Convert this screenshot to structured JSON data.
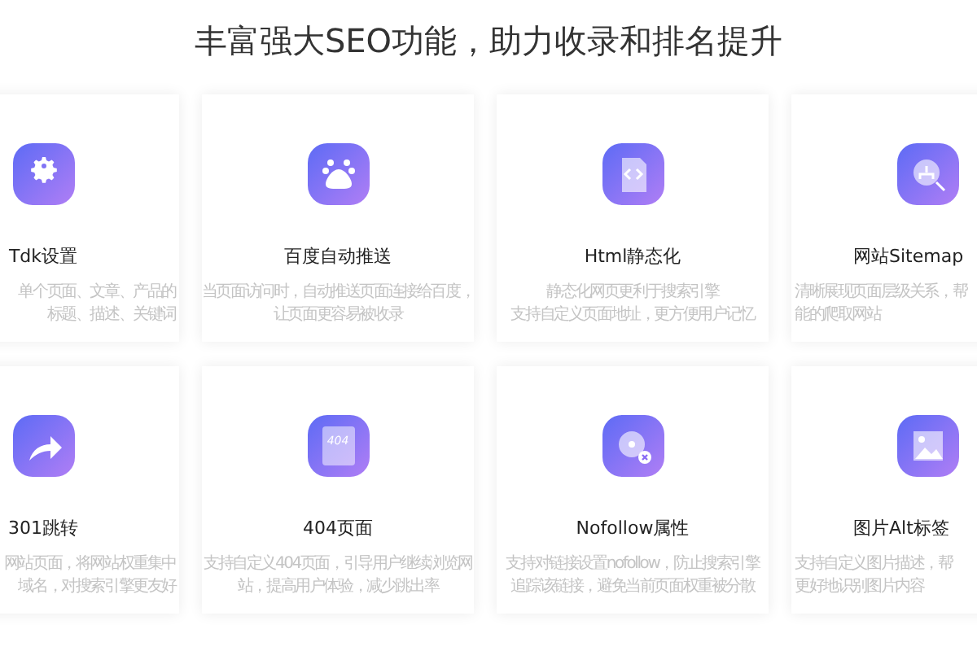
{
  "heading": "丰富强大SEO功能，助力收录和排名提升",
  "cards": [
    {
      "title": "Tdk设置",
      "description": [
        "单个页面、文章、产品的",
        "标题、描述、关键词"
      ]
    },
    {
      "title": "百度自动推送",
      "description": [
        "当页面访问时，自动推送页面连接给百度，",
        "让页面更容易被收录"
      ]
    },
    {
      "title": "Html静态化",
      "description": [
        "静态化网页更利于搜索引擎",
        "支持自定义页面地址，更方便用户记忆"
      ]
    },
    {
      "title": "网站Sitemap",
      "description": [
        "清晰展现页面层级关系，帮",
        "能的爬取网站"
      ]
    },
    {
      "title": "301跳转",
      "description": [
        "网站页面，将网站权重集中",
        "域名，对搜索引擎更友好"
      ]
    },
    {
      "icon_text": "404",
      "title": "404页面",
      "description": [
        "支持自定义404页面，引导用户继续浏览网",
        "站，提高用户体验，减少跳出率"
      ]
    },
    {
      "title": "Nofollow属性",
      "description": [
        "支持对链接设置nofollow，防止搜索引擎",
        "追踪该链接，避免当前页面权重被分散"
      ]
    },
    {
      "title": "图片Alt标签",
      "description": [
        "支持自定义图片描述，帮",
        "更好地识别图片内容"
      ]
    }
  ]
}
